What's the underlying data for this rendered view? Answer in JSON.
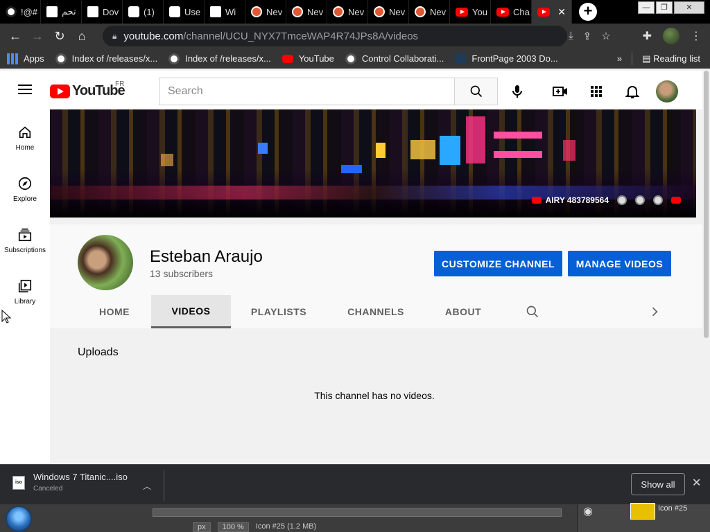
{
  "browser": {
    "tabs": [
      {
        "label": "!@#",
        "favicon": "globe-icon"
      },
      {
        "label": "تحم",
        "favicon": "face-icon"
      },
      {
        "label": "Dov",
        "favicon": "face-icon"
      },
      {
        "label": "(1)",
        "favicon": "drive-icon"
      },
      {
        "label": "Use",
        "favicon": "drive-icon"
      },
      {
        "label": "Wi",
        "favicon": "museum-icon"
      },
      {
        "label": "Nev",
        "favicon": "duckduckgo-icon"
      },
      {
        "label": "Nev",
        "favicon": "duckduckgo-icon"
      },
      {
        "label": "Nev",
        "favicon": "duckduckgo-icon"
      },
      {
        "label": "Nev",
        "favicon": "duckduckgo-icon"
      },
      {
        "label": "Nev",
        "favicon": "duckduckgo-icon"
      },
      {
        "label": "You",
        "favicon": "youtube-icon"
      },
      {
        "label": "Cha",
        "favicon": "youtube-icon"
      }
    ],
    "active_tab_close": "✕",
    "new_tab": "+",
    "url_host": "youtube.com",
    "url_path": "/channel/UCU_NYX7TmceWAP4R74JPs8A/videos",
    "bookmarks": [
      {
        "label": "Apps",
        "icon": "apps-grid-icon"
      },
      {
        "label": "Index of /releases/x...",
        "icon": "globe-icon"
      },
      {
        "label": "Index of /releases/x...",
        "icon": "globe-icon"
      },
      {
        "label": "YouTube",
        "icon": "youtube-icon"
      },
      {
        "label": "Control Collaborati...",
        "icon": "globe-icon"
      },
      {
        "label": "FrontPage 2003 Do...",
        "icon": "frontpage-icon"
      }
    ],
    "bookmarks_overflow": "»",
    "reading_list": "Reading list"
  },
  "youtube": {
    "logo_text": "YouTube",
    "country_code": "FR",
    "search_placeholder": "Search",
    "guide": [
      {
        "label": "Home",
        "icon": "home-icon"
      },
      {
        "label": "Explore",
        "icon": "compass-icon"
      },
      {
        "label": "Subscriptions",
        "icon": "subscriptions-icon"
      },
      {
        "label": "Library",
        "icon": "library-icon"
      }
    ],
    "banner_link": "AIRY 483789564",
    "channel": {
      "name": "Esteban Araujo",
      "subscribers": "13 subscribers",
      "customize_button": "CUSTOMIZE CHANNEL",
      "manage_button": "MANAGE VIDEOS"
    },
    "channel_tabs": [
      {
        "label": "HOME",
        "selected": false
      },
      {
        "label": "VIDEOS",
        "selected": true
      },
      {
        "label": "PLAYLISTS",
        "selected": false
      },
      {
        "label": "CHANNELS",
        "selected": false
      },
      {
        "label": "ABOUT",
        "selected": false
      }
    ],
    "section_title": "Uploads",
    "empty_message": "This channel has no videos."
  },
  "download_shelf": {
    "file_name": "Windows 7 Titanic....iso",
    "status": "Canceled",
    "file_icon_text": "iso",
    "show_all": "Show all"
  },
  "background_app": {
    "unit": "px",
    "zoom": "100 %",
    "status": "Icon #25 (1.2 MB)",
    "layer_name": "Icon #25"
  },
  "colors": {
    "youtube_red": "#ff0000",
    "primary_blue": "#065fd4",
    "browser_dark": "#353535"
  }
}
